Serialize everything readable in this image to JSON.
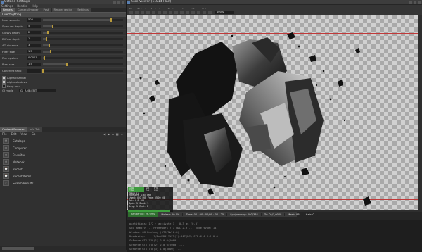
{
  "left_window": {
    "title": "Octane Settings",
    "menus": [
      "Settings",
      "Render",
      "Help"
    ],
    "tabs": [
      "Kernels",
      "Camera/Imager",
      "Post",
      "Render region",
      "Settings"
    ],
    "active_tab": 0,
    "section_label": "Directlighting",
    "params": [
      {
        "label": "Max. samples",
        "value": "500",
        "fill": 0.85
      },
      {
        "label": "Specular depth",
        "value": "5",
        "fill": 0.12
      },
      {
        "label": "Glossy depth",
        "value": "2",
        "fill": 0.06
      },
      {
        "label": "Diffuse depth",
        "value": "1",
        "fill": 0.04
      },
      {
        "label": "AO distance",
        "value": "3",
        "fill": 0.08
      },
      {
        "label": "Filter size",
        "value": "1.5",
        "fill": 0.1
      },
      {
        "label": "Ray epsilon",
        "value": "0.0001",
        "fill": 0.02
      },
      {
        "label": "Pixel size",
        "value": "1.5",
        "fill": 0.3
      },
      {
        "label": "Coherent ratio",
        "value": "",
        "fill": 0.0
      }
    ],
    "checks": [
      {
        "label": "Alpha channel",
        "on": true
      },
      {
        "label": "Alpha shadows",
        "on": true
      },
      {
        "label": "Keep env.",
        "on": false
      }
    ],
    "select": {
      "label": "GI mode",
      "value": "GI_AMBIENT"
    }
  },
  "content_browser": {
    "tabs": [
      "Content Browser",
      "Info Tab"
    ],
    "toolbar": [
      "File",
      "Edit",
      "View",
      "Go"
    ],
    "items": [
      "Catalogs",
      "Computer",
      "Favorites",
      "Network",
      "Recent",
      "Recent Items",
      "Search Results"
    ]
  },
  "viewer": {
    "title": "Core Viewer (11014 Plan)",
    "menus": [
      "File",
      "Objects",
      "Materials",
      "Options",
      "Help",
      "View",
      "Vol"
    ],
    "zoom": "100%",
    "tools": [
      "select",
      "move",
      "rotate",
      "scale",
      "camera",
      "light",
      "render",
      "pause",
      "stop",
      "refresh",
      "region",
      "pick",
      "focus",
      "settings",
      "snapshot"
    ]
  },
  "stats": {
    "gpus": [
      {
        "name": "GTX TRI(1.1)",
        "a": "Sel",
        "b": "0%"
      },
      {
        "name": "GTX TRI(1.1)",
        "a": "Sel",
        "b": "0%"
      }
    ],
    "lines": [
      [
        "Memory:",
        "0.64 MB",
        "",
        ""
      ],
      [
        "Used:",
        "0.0",
        "MB",
        "Free: 3500 MB"
      ],
      [
        "Tris:",
        "0.8",
        "MB",
        ""
      ],
      [
        "Spld:",
        "1",
        "Spnt:",
        "1"
      ],
      [
        "Sray:",
        "1",
        "Gmt:",
        "1"
      ]
    ],
    "progress": 0.92
  },
  "status_bar": {
    "rendering": "Rendering: 26.99%",
    "ms": "Ms/sec: 20.0%",
    "time": "Time: 00 : 00 : 00/00 : 00 : 25",
    "spp": "Spp/maxspp: 000/384",
    "tri": "Tri: 0k/1,000k",
    "mesh": "Mesh: 96",
    "hair": "Hair: 0"
  },
  "console_lines": [
    "partitions: 1/2 · activate:1 · 0.3 ms (0.0)",
    "Gpu memory ... Framework 7 / MDL 2.9 ... node type: 14",
    "Window: GG Fantasy (1TS/NW·6.8)",
    "Rendering: ... 1/Rnd/Rf·INIT(I)·RAI(RG)·SCE·6.4.4·1.0.0",
    "GeForce GTX 780(1) 2.0 0(1000) ...",
    "GeForce GTX 780(2) 2.0 0(2000) ...",
    "GeForce GTX 780(3) 1 0(3000) ..."
  ]
}
